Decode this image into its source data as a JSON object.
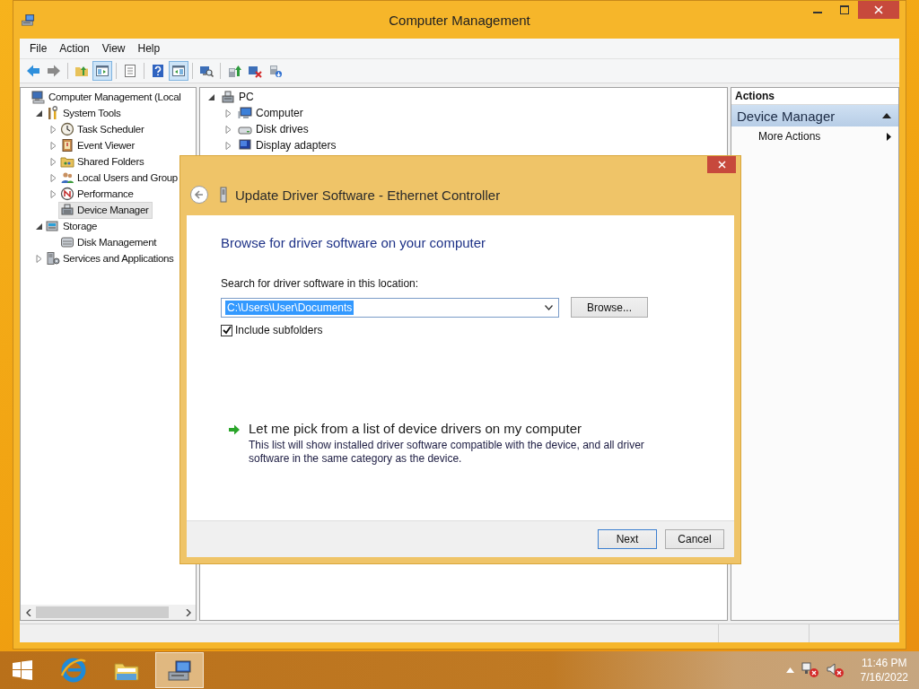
{
  "window": {
    "title": "Computer Management"
  },
  "menu": [
    "File",
    "Action",
    "View",
    "Help"
  ],
  "toolbar": [
    {
      "kind": "back",
      "pressed": false
    },
    {
      "kind": "forward",
      "pressed": false
    },
    {
      "kind": "separator"
    },
    {
      "kind": "up",
      "pressed": false
    },
    {
      "kind": "tree",
      "pressed": true
    },
    {
      "kind": "separator"
    },
    {
      "kind": "properties",
      "pressed": false
    },
    {
      "kind": "separator"
    },
    {
      "kind": "help",
      "pressed": false
    },
    {
      "kind": "pane",
      "pressed": true
    },
    {
      "kind": "separator"
    },
    {
      "kind": "scan",
      "pressed": false
    },
    {
      "kind": "separator"
    },
    {
      "kind": "update",
      "pressed": false
    },
    {
      "kind": "disable",
      "pressed": false
    },
    {
      "kind": "uninstall",
      "pressed": false
    }
  ],
  "console_tree": {
    "items": [
      {
        "label": "Computer Management (Local",
        "kind": "computer",
        "selected": false,
        "children": [
          {
            "label": "System Tools",
            "kind": "tools",
            "selected": false,
            "expanded": true,
            "children": [
              {
                "label": "Task Scheduler",
                "kind": "clock",
                "selected": false,
                "expanded": false
              },
              {
                "label": "Event Viewer",
                "kind": "log",
                "selected": false,
                "expanded": false
              },
              {
                "label": "Shared Folders",
                "kind": "folder",
                "selected": false,
                "expanded": false
              },
              {
                "label": "Local Users and Group",
                "kind": "users",
                "selected": false,
                "expanded": false
              },
              {
                "label": "Performance",
                "kind": "gauge",
                "selected": false,
                "expanded": false
              },
              {
                "label": "Device Manager",
                "kind": "device",
                "selected": true
              }
            ]
          },
          {
            "label": "Storage",
            "kind": "storage",
            "selected": false,
            "expanded": true,
            "children": [
              {
                "label": "Disk Management",
                "kind": "disk",
                "selected": false
              }
            ]
          },
          {
            "label": "Services and Applications",
            "kind": "services",
            "selected": false,
            "expanded": false
          }
        ]
      }
    ]
  },
  "device_tree": {
    "items": [
      {
        "label": "PC",
        "kind": "pc",
        "selected": false,
        "expanded": true,
        "children": [
          {
            "label": "Computer",
            "kind": "monitor",
            "selected": false,
            "expanded": false
          },
          {
            "label": "Disk drives",
            "kind": "drive",
            "selected": false,
            "expanded": false
          },
          {
            "label": "Display adapters",
            "kind": "display",
            "selected": false,
            "expanded": false
          }
        ]
      }
    ]
  },
  "actions": {
    "header": "Actions",
    "section": {
      "label": "Device Manager",
      "expanded": true
    },
    "items": [
      {
        "label": "More Actions"
      }
    ]
  },
  "dialog": {
    "title": "Update Driver Software - Ethernet Controller",
    "heading": "Browse for driver software on your computer",
    "location_label": "Search for driver software in this location:",
    "location": {
      "value": "C:\\Users\\User\\Documents",
      "highlighted": true
    },
    "browse_button": "Browse...",
    "include_subfolders": {
      "label": "Include subfolders",
      "checked": true
    },
    "option": {
      "title": "Let me pick from a list of device drivers on my computer",
      "description": "This list will show installed driver software compatible with the device, and all driver software in the same category as the device."
    },
    "buttons": [
      {
        "label": "Next",
        "default": true
      },
      {
        "label": "Cancel",
        "default": false
      }
    ]
  },
  "taskbar": {
    "apps": [
      {
        "kind": "browser",
        "active": false
      },
      {
        "kind": "explorer",
        "active": false
      },
      {
        "kind": "management",
        "active": true
      }
    ],
    "time": "11:46 PM",
    "date": "7/16/2022"
  }
}
